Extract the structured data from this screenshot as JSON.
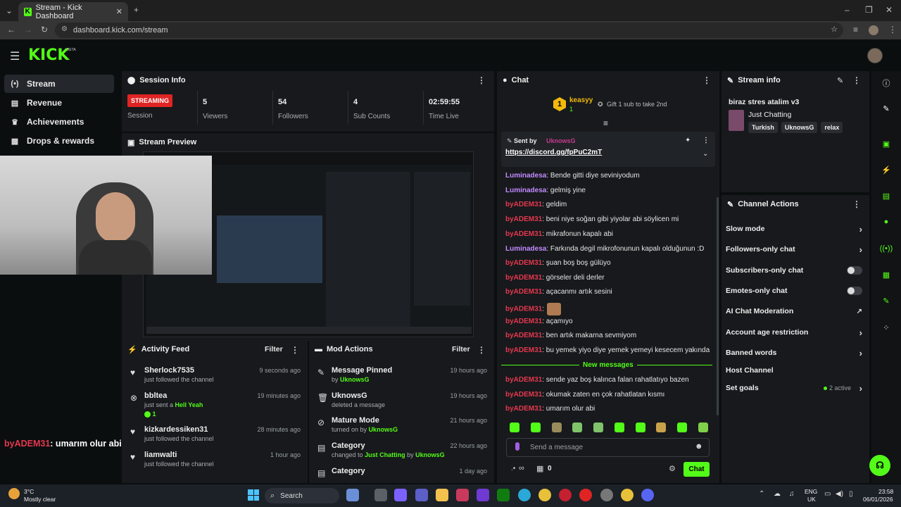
{
  "browser": {
    "tab_title": "Stream - Kick Dashboard",
    "url": "dashboard.kick.com/stream"
  },
  "header": {
    "logo": "KICK",
    "beta": "BETA"
  },
  "sidebar": {
    "items": [
      {
        "label": "Stream",
        "icon": "stream-icon"
      },
      {
        "label": "Revenue",
        "icon": "revenue-icon"
      },
      {
        "label": "Achievements",
        "icon": "trophy-icon"
      },
      {
        "label": "Drops & rewards",
        "icon": "gift-icon"
      }
    ]
  },
  "session": {
    "title": "Session Info",
    "status": "STREAMING",
    "status_label": "Session",
    "stats": [
      {
        "value": "5",
        "label": "Viewers"
      },
      {
        "value": "54",
        "label": "Followers"
      },
      {
        "value": "4",
        "label": "Sub Counts"
      },
      {
        "value": "02:59:55",
        "label": "Time Live"
      }
    ]
  },
  "preview": {
    "title": "Stream Preview"
  },
  "overlay_chat": {
    "user": "byADEM31",
    "text": ": umarım olur abi"
  },
  "activity": {
    "title": "Activity Feed",
    "filter": "Filter",
    "items": [
      {
        "name": "Sherlock7535",
        "time": "9 seconds ago",
        "sub": "just followed the channel",
        "icon": "heart-icon"
      },
      {
        "name": "bbltea",
        "time": "19 minutes ago",
        "sub": "just sent a",
        "sub_link": "Hell Yeah",
        "sub_extra": "1",
        "icon": "kick-icon"
      },
      {
        "name": "kizkardessiken31",
        "time": "28 minutes ago",
        "sub": "just followed the channel",
        "icon": "heart-icon"
      },
      {
        "name": "liamwalti",
        "time": "1 hour ago",
        "sub": "just followed the channel",
        "icon": "heart-icon"
      }
    ]
  },
  "mod": {
    "title": "Mod Actions",
    "filter": "Filter",
    "items": [
      {
        "name": "Message Pinned",
        "time": "19 hours ago",
        "sub_pre": "by",
        "sub_link": "UknowsG",
        "icon": "pin-icon"
      },
      {
        "name": "UknowsG",
        "time": "19 hours ago",
        "sub_pre": "deleted a message",
        "sub_link": "",
        "icon": "trash-icon"
      },
      {
        "name": "Mature Mode",
        "time": "21 hours ago",
        "sub_pre": "turned on by",
        "sub_link": "UknowsG",
        "icon": "eye-off-icon"
      },
      {
        "name": "Category",
        "time": "22 hours ago",
        "sub_pre": "changed to",
        "sub_link": "Just Chatting",
        "sub_mid": "by",
        "sub_link2": "UknowsG",
        "icon": "category-icon"
      },
      {
        "name": "Category",
        "time": "1 day ago",
        "sub_pre": "",
        "sub_link": "",
        "icon": "category-icon"
      }
    ]
  },
  "chat": {
    "title": "Chat",
    "gifter": {
      "name": "keasyy",
      "rank": "1",
      "count": "1",
      "gift_text": "Gift 1 sub to take 2nd"
    },
    "pinned": {
      "sent_by": "Sent by",
      "user": "UknowsG",
      "link": "https://discord.gg/fpPuC2mT"
    },
    "messages": [
      {
        "user": "Luminadesa",
        "color": "purple",
        "text": ": Bende gitti diye seviniyodum"
      },
      {
        "user": "Luminadesa",
        "color": "purple",
        "text": ": gelmiş yine"
      },
      {
        "user": "byADEM31",
        "color": "red",
        "text": ": geldim"
      },
      {
        "user": "byADEM31",
        "color": "red",
        "text": ": beni niye soğan gibi yiyolar abi söylicen mi"
      },
      {
        "user": "byADEM31",
        "color": "red",
        "text": ": mikrafonun kapalı abi"
      },
      {
        "user": "Luminadesa",
        "color": "purple",
        "text": ": Farkında degil mikrofonunun kapalı olduğunun :D"
      },
      {
        "user": "byADEM31",
        "color": "red",
        "text": ": şuan boş boş gülüyo"
      },
      {
        "user": "byADEM31",
        "color": "red",
        "text": ": görseler deli derler"
      },
      {
        "user": "byADEM31",
        "color": "red",
        "text": ": açacanmı artık sesini"
      },
      {
        "user": "byADEM31",
        "color": "red",
        "text": ":"
      },
      {
        "user": "byADEM31",
        "color": "red",
        "text": ": açamıyo"
      },
      {
        "user": "byADEM31",
        "color": "red",
        "text": ": ben artık makarna sevmiyom"
      },
      {
        "user": "byADEM31",
        "color": "red",
        "text": ": bu yemek yiyo diye yemek yemeyi kesecem yakında"
      }
    ],
    "new_messages_label": "New messages",
    "new_messages": [
      {
        "user": "byADEM31",
        "color": "red",
        "text": ": sende yaz boş kalınca falan rahatlatıyo bazen"
      },
      {
        "user": "byADEM31",
        "color": "red",
        "text": ": okumak zaten en çok rahatlatan kısmı"
      },
      {
        "user": "byADEM31",
        "color": "red",
        "text": ": umarım olur abi"
      }
    ],
    "input_placeholder": "Send a message",
    "infinity": "∞",
    "sub_count": "0",
    "send_label": "Chat"
  },
  "stream_info": {
    "title": "Stream info",
    "stream_title": "biraz stres atalim v3",
    "category": "Just Chatting",
    "tags": [
      "Turkish",
      "UknowsG",
      "relax"
    ]
  },
  "channel_actions": {
    "title": "Channel Actions",
    "items": [
      {
        "label": "Slow mode",
        "control": "chevron"
      },
      {
        "label": "Followers-only chat",
        "control": "chevron"
      },
      {
        "label": "Subscribers-only chat",
        "control": "toggle"
      },
      {
        "label": "Emotes-only chat",
        "control": "toggle"
      },
      {
        "label": "AI Chat Moderation",
        "control": "external"
      },
      {
        "label": "Account age restriction",
        "control": "chevron"
      },
      {
        "label": "Banned words",
        "control": "chevron"
      },
      {
        "label": "Host Channel",
        "control": "none"
      },
      {
        "label": "Set goals",
        "control": "chevron",
        "extra": "2 active"
      }
    ]
  },
  "taskbar": {
    "weather_temp": "3°C",
    "weather_desc": "Mostly clear",
    "search_label": "Search",
    "lang": "ENG",
    "region": "UK",
    "time": "23:58",
    "date": "06/01/2026"
  },
  "colors": {
    "kick_green": "#53fc18",
    "streaming_red": "#e02424",
    "panel_bg": "#17191c"
  }
}
